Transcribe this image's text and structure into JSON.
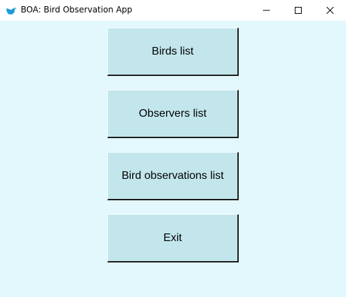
{
  "window": {
    "title": "BOA: Bird Observation App",
    "icon": "bird-icon",
    "controls": [
      "minimize-icon",
      "maximize-icon",
      "close-icon"
    ]
  },
  "menu": {
    "birds_list": "Birds list",
    "observers_list": "Observers list",
    "bird_observations_list": "Bird observations list",
    "exit": "Exit"
  },
  "colors": {
    "background": "#e3f8fc",
    "button": "#c2e6ec",
    "icon_accent": "#1e9bd7"
  }
}
